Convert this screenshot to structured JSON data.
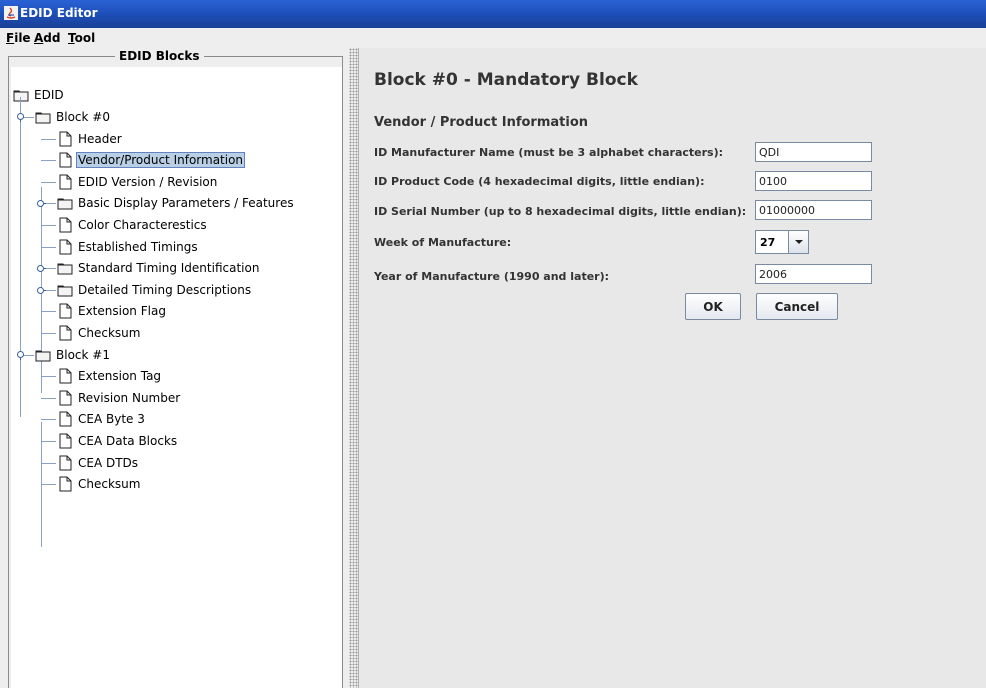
{
  "window": {
    "title": "EDID Editor",
    "icon": "java-icon"
  },
  "menu": {
    "file": {
      "mnemonic": "F",
      "rest": "ile"
    },
    "add": {
      "mnemonic": "A",
      "rest": "dd"
    },
    "tool": {
      "mnemonic": "T",
      "rest": "ool"
    }
  },
  "tree": {
    "group_title": "EDID Blocks",
    "root": "EDID",
    "items": [
      {
        "label": "Block #0",
        "type": "folder"
      },
      {
        "label": "Header",
        "type": "leaf"
      },
      {
        "label": "Vendor/Product Information",
        "type": "leaf",
        "selected": true
      },
      {
        "label": "EDID Version / Revision",
        "type": "leaf"
      },
      {
        "label": "Basic Display Parameters / Features",
        "type": "folder"
      },
      {
        "label": "Color Characterestics",
        "type": "leaf"
      },
      {
        "label": "Established Timings",
        "type": "leaf"
      },
      {
        "label": "Standard Timing Identification",
        "type": "folder"
      },
      {
        "label": "Detailed Timing Descriptions",
        "type": "folder"
      },
      {
        "label": "Extension Flag",
        "type": "leaf"
      },
      {
        "label": "Checksum",
        "type": "leaf"
      },
      {
        "label": "Block #1",
        "type": "folder"
      },
      {
        "label": "Extension Tag",
        "type": "leaf"
      },
      {
        "label": "Revision Number",
        "type": "leaf"
      },
      {
        "label": "CEA Byte 3",
        "type": "leaf"
      },
      {
        "label": "CEA Data Blocks",
        "type": "leaf"
      },
      {
        "label": "CEA DTDs",
        "type": "leaf"
      },
      {
        "label": "Checksum",
        "type": "leaf"
      }
    ]
  },
  "main": {
    "block_title": "Block #0 - Mandatory Block",
    "section_title": "Vendor / Product Information",
    "fields": {
      "manufacturer": {
        "label": "ID Manufacturer Name (must be 3 alphabet characters):",
        "value": "QDI"
      },
      "product_code": {
        "label": "ID Product Code (4 hexadecimal digits, little endian):",
        "value": "0100"
      },
      "serial": {
        "label": "ID Serial Number (up to 8 hexadecimal digits, little endian):",
        "value": "01000000"
      },
      "week": {
        "label": "Week of Manufacture:",
        "value": "27"
      },
      "year": {
        "label": "Year of Manufacture (1990 and later):",
        "value": "2006"
      }
    },
    "ok_label": "OK",
    "cancel_label": "Cancel"
  }
}
